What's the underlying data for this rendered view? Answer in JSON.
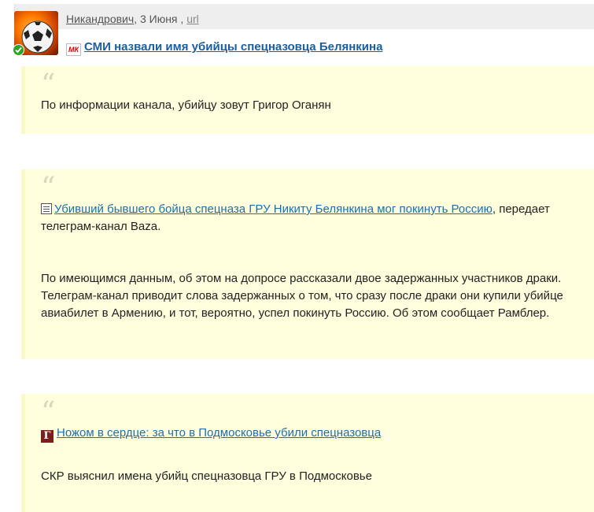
{
  "post": {
    "author": "Никандрович",
    "date": ", 3 Июня , ",
    "url_label": "url",
    "title": "СМИ назвали имя убийцы спецназовца Белянкина",
    "source_icon_text": "МК"
  },
  "quotes": [
    {
      "mark": "“",
      "text": "По информации канала, убийцу зовут Григор Оганян"
    },
    {
      "mark": "“",
      "link": "Убивший бывшего бойца спецназа ГРУ Никиту Белянкина мог покинуть Россию",
      "after_link": ", передает телеграм-канал Baza.",
      "paragraph": "По имеющимся данным, об этом на допросе рассказали двое задержанных участников драки. Телеграм-канал приводит слова задержанных о том, что сразу после драки они купили убийце авиабилет в Армению, и тот, вероятно, успел покинуть Россию. Об этом сообщает Рамблер."
    },
    {
      "mark": "“",
      "icon_text": "Г",
      "link": "Ножом в сердце: за что в Подмосковье убили спецназовца",
      "paragraph": "СКР выяснил имена убийц спецназовца ГРУ в Подмосковье"
    }
  ],
  "colors": {
    "quote_bg": "#ffffde",
    "link": "#1a6fb0",
    "title_link": "#1a5fa0"
  }
}
